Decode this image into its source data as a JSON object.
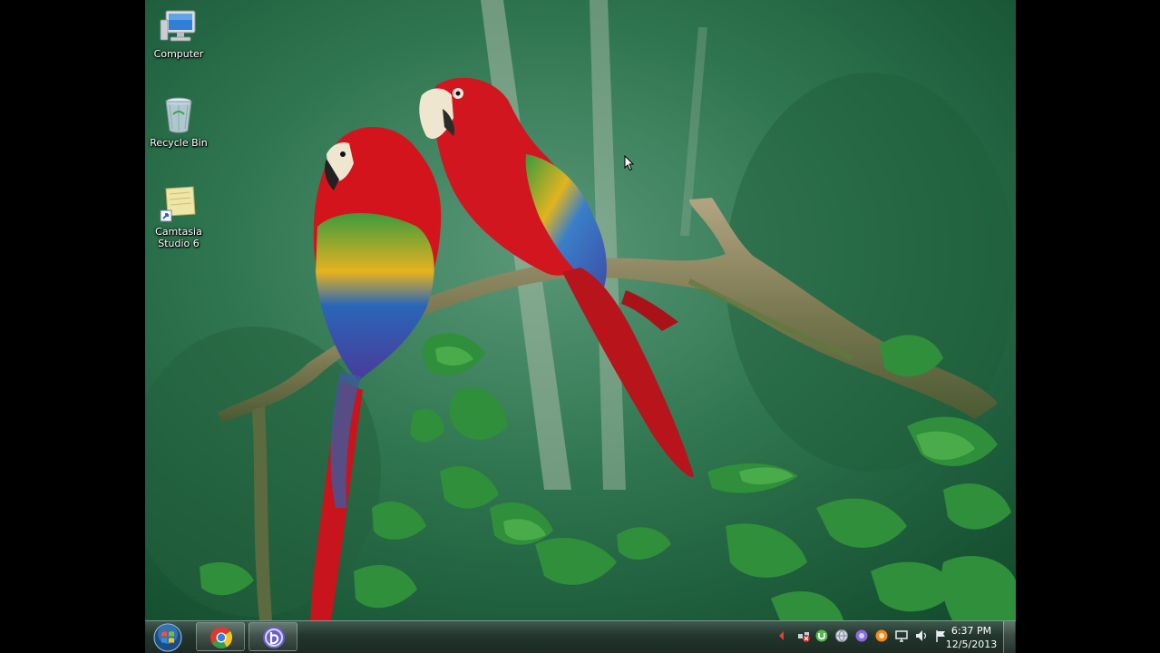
{
  "desktop": {
    "icons": [
      {
        "name": "computer-icon",
        "label": "Computer"
      },
      {
        "name": "recycle-bin-icon",
        "label": "Recycle Bin"
      },
      {
        "name": "camtasia-icon",
        "label": "Camtasia Studio 6"
      }
    ],
    "wallpaper": "two scarlet macaws perched on a mossy branch with green foliage"
  },
  "taskbar": {
    "start_button": "windows-start-orb-icon",
    "pinned": [
      {
        "name": "chrome-icon"
      },
      {
        "name": "bittorrent-icon"
      }
    ],
    "tray_icons": [
      "show-hidden-icons-icon",
      "network-status-icon",
      "utorrent-tray-icon",
      "globe-tray-icon",
      "purple-tray-icon",
      "orange-tray-icon",
      "display-tray-icon",
      "volume-icon",
      "action-center-flag-icon"
    ],
    "clock": {
      "time": "6:37 PM",
      "date": "12/5/2013"
    }
  },
  "colors": {
    "taskbar": "#22352d",
    "parrot_red": "#d01820",
    "foliage": "#2f8a3a"
  }
}
